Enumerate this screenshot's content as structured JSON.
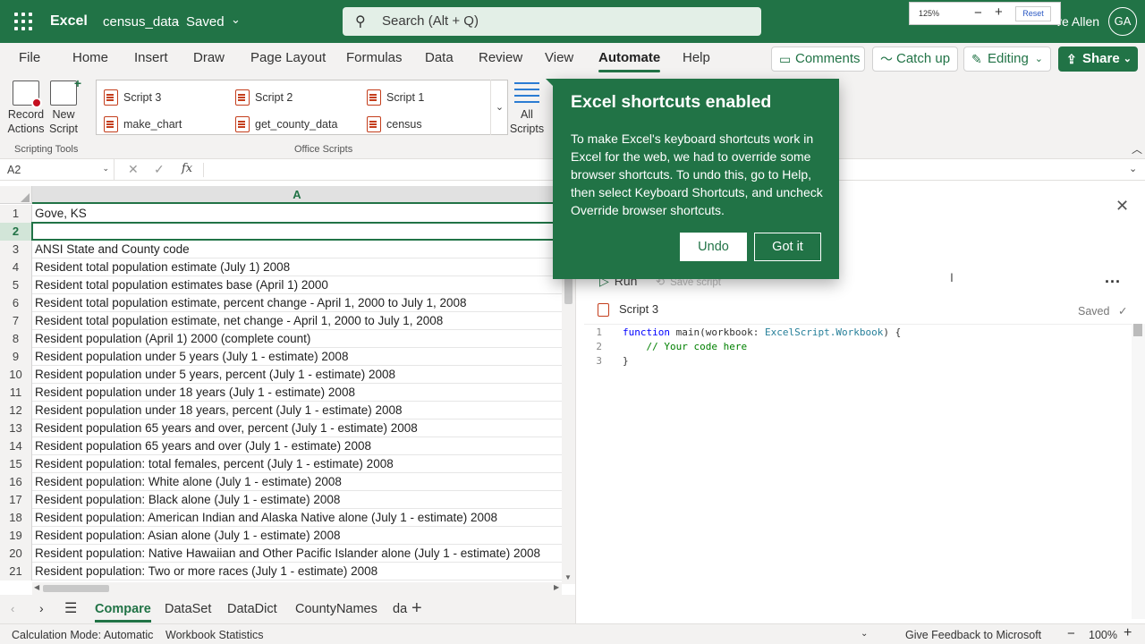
{
  "titlebar": {
    "app_name": "Excel",
    "doc_name": "census_data",
    "doc_sep": "-",
    "doc_status": "Saved",
    "search_placeholder": "Search (Alt + Q)",
    "user_name": "ve Allen",
    "avatar_initials": "GA"
  },
  "zoom_popup": {
    "percent": "125%",
    "minus": "−",
    "plus": "+",
    "reset": "Reset"
  },
  "tabs": [
    "File",
    "Home",
    "Insert",
    "Draw",
    "Page Layout",
    "Formulas",
    "Data",
    "Review",
    "View",
    "Automate",
    "Help"
  ],
  "active_tab": "Automate",
  "header_buttons": {
    "comments": "Comments",
    "catchup": "Catch up",
    "editing": "Editing",
    "share": "Share"
  },
  "ribbon": {
    "record_actions": "Record Actions",
    "new_script": "New Script",
    "group_scripting": "Scripting Tools",
    "group_office": "Office Scripts",
    "all_scripts": "All Scripts",
    "scripts": [
      "Script 3",
      "Script 2",
      "Script 1",
      "make_chart",
      "get_county_data",
      "census"
    ]
  },
  "formula_bar": {
    "name_box": "A2",
    "fx": "fx",
    "cancel": "✕",
    "enter": "✓"
  },
  "sheet": {
    "column_header": "A",
    "rows": [
      {
        "n": "1",
        "v": "Gove,  KS"
      },
      {
        "n": "2",
        "v": ""
      },
      {
        "n": "3",
        "v": "ANSI State and County code"
      },
      {
        "n": "4",
        "v": "Resident total population estimate (July 1) 2008"
      },
      {
        "n": "5",
        "v": "Resident total population estimates base (April 1) 2000"
      },
      {
        "n": "6",
        "v": "Resident total population estimate, percent change - April 1, 2000 to July 1, 2008"
      },
      {
        "n": "7",
        "v": "Resident total population estimate, net change - April 1, 2000 to July 1, 2008"
      },
      {
        "n": "8",
        "v": "Resident population (April 1) 2000 (complete count)"
      },
      {
        "n": "9",
        "v": "Resident population under 5 years (July 1 - estimate) 2008"
      },
      {
        "n": "10",
        "v": "Resident population under 5 years, percent (July 1 - estimate) 2008"
      },
      {
        "n": "11",
        "v": "Resident population under 18 years (July 1 - estimate) 2008"
      },
      {
        "n": "12",
        "v": "Resident population under 18 years, percent (July 1 - estimate) 2008"
      },
      {
        "n": "13",
        "v": "Resident population 65 years and over, percent (July 1 - estimate) 2008"
      },
      {
        "n": "14",
        "v": "Resident population 65 years and over (July 1 - estimate) 2008"
      },
      {
        "n": "15",
        "v": "Resident population: total females, percent (July 1 - estimate) 2008"
      },
      {
        "n": "16",
        "v": "Resident population: White alone (July 1 - estimate) 2008"
      },
      {
        "n": "17",
        "v": "Resident population: Black alone (July 1 - estimate) 2008"
      },
      {
        "n": "18",
        "v": "Resident population: American Indian and Alaska Native alone (July 1 - estimate) 2008"
      },
      {
        "n": "19",
        "v": "Resident population: Asian alone (July 1 - estimate) 2008"
      },
      {
        "n": "20",
        "v": "Resident population: Native Hawaiian and Other Pacific Islander alone (July 1 - estimate) 2008"
      },
      {
        "n": "21",
        "v": "Resident population: Two or more races (July 1 - estimate) 2008"
      }
    ],
    "selected_row": "2"
  },
  "sheet_tabs": [
    "Compare",
    "DataSet",
    "DataDict",
    "CountyNames",
    "da"
  ],
  "active_sheet": "Compare",
  "status_bar": {
    "calc_mode": "Calculation Mode: Automatic",
    "workbook_stats": "Workbook Statistics",
    "feedback": "Give Feedback to Microsoft",
    "zoom_minus": "−",
    "zoom": "100%",
    "zoom_plus": "+"
  },
  "code_pane": {
    "run": "Run",
    "save_script": "Save script",
    "more": "...",
    "script_name": "Script 3",
    "saved": "Saved",
    "code_lines": [
      {
        "n": "1",
        "kw": "function",
        "rest1": " main(workbook: ",
        "ty": "ExcelScript.Workbook",
        "rest2": ") {"
      },
      {
        "n": "2",
        "comment": "    // Your code here"
      },
      {
        "n": "3",
        "text": "}"
      }
    ]
  },
  "popup": {
    "title": "Excel shortcuts enabled",
    "body": "To make Excel's keyboard shortcuts work in Excel for the web, we had to override some browser shortcuts. To undo this, go to Help, then select Keyboard Shortcuts, and uncheck Override browser shortcuts.",
    "undo": "Undo",
    "got_it": "Got it"
  },
  "colors": {
    "excel_green": "#217346",
    "accent_blue": "#2b7cd3",
    "script_icon": "#c43e1c"
  }
}
